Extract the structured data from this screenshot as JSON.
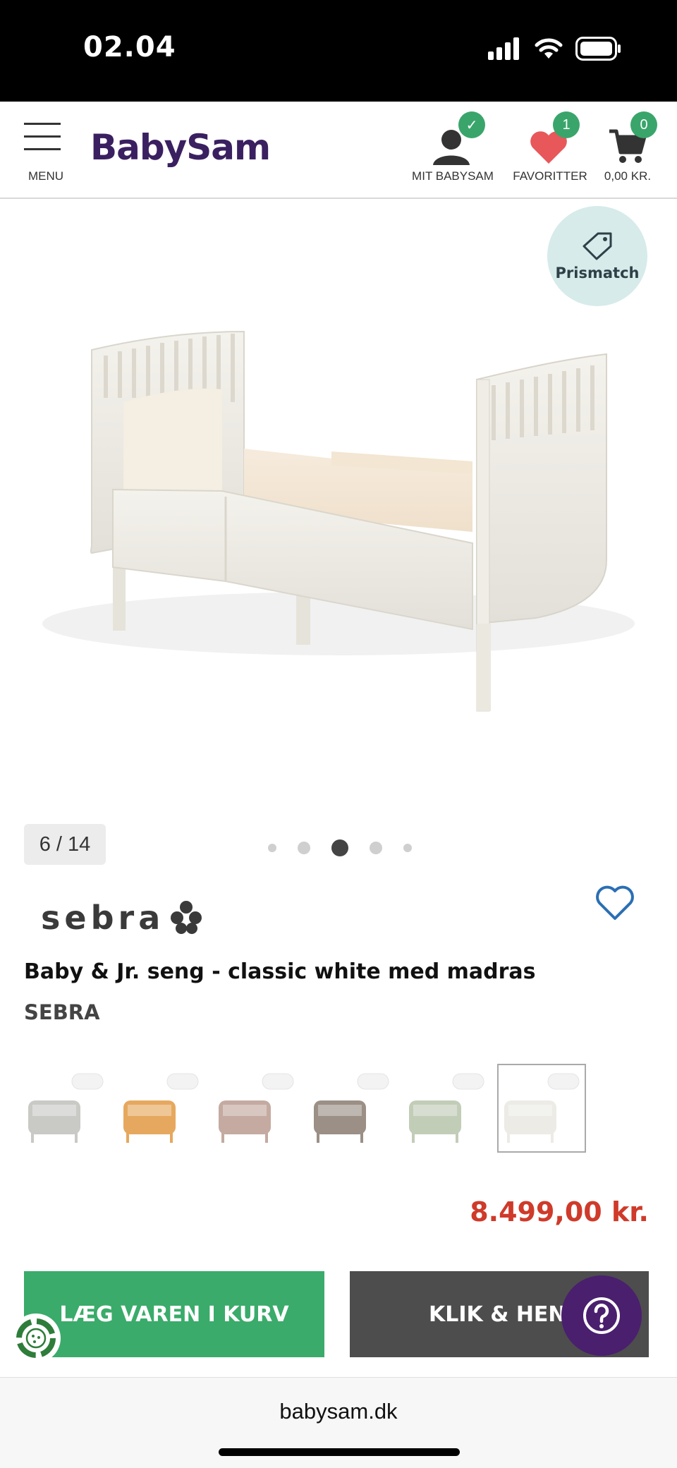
{
  "status_bar": {
    "time": "02.04"
  },
  "header": {
    "menu_label": "MENU",
    "logo": "BabySam",
    "account_label": "MIT BABYSAM",
    "favorites_label": "FAVORITTER",
    "favorites_count": "1",
    "cart_label": "0,00 KR.",
    "cart_count": "0"
  },
  "gallery": {
    "prismatch_label": "Prismatch",
    "counter": "6 / 14",
    "dots_total": 5,
    "dots_active_index": 2
  },
  "product": {
    "brand_logo": "sebra",
    "title": "Baby & Jr. seng - classic white med madras",
    "brand": "SEBRA",
    "price": "8.499,00 kr.",
    "swatches": [
      {
        "color": "grey",
        "tone": "#c9c9c6"
      },
      {
        "color": "honey",
        "tone": "#e6a85e"
      },
      {
        "color": "rose",
        "tone": "#c4aaa0"
      },
      {
        "color": "taupe",
        "tone": "#9b8f86"
      },
      {
        "color": "mint",
        "tone": "#c2cdb8"
      },
      {
        "color": "classic white",
        "tone": "#ecebe6"
      }
    ],
    "selected_swatch": 5
  },
  "actions": {
    "add_to_cart": "LÆG VAREN I KURV",
    "click_collect": "KLIK & HENT"
  },
  "browser": {
    "url": "babysam.dk"
  },
  "colors": {
    "brand_purple": "#3a2060",
    "green": "#3aab6a",
    "price_red": "#cf3a2a",
    "dark_button": "#4d4d4d"
  }
}
